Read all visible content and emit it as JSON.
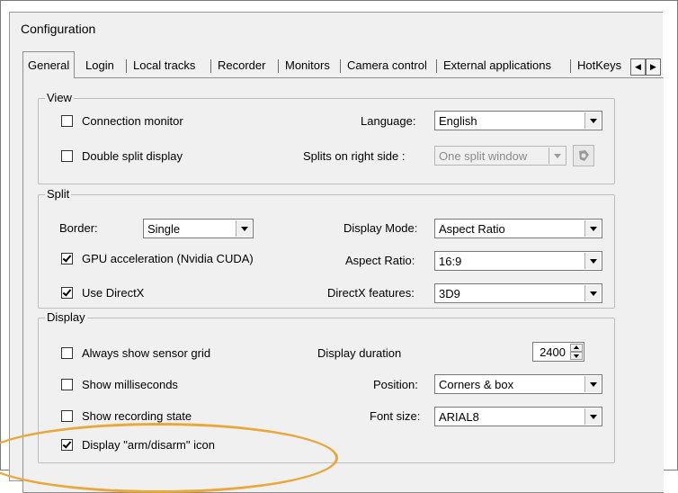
{
  "window": {
    "title": "Configuration"
  },
  "tabs": [
    "General",
    "Login",
    "Local tracks",
    "Recorder",
    "Monitors",
    "Camera control",
    "External applications",
    "HotKeys"
  ],
  "view": {
    "legend": "View",
    "connection_monitor": "Connection monitor",
    "double_split": "Double split display",
    "language_label": "Language:",
    "language_value": "English",
    "splits_label": "Splits on right side :",
    "splits_value": "One split window"
  },
  "split": {
    "legend": "Split",
    "border_label": "Border:",
    "border_value": "Single",
    "gpu_label": "GPU acceleration (Nvidia CUDA)",
    "directx_label": "Use DirectX",
    "display_mode_label": "Display Mode:",
    "display_mode_value": "Aspect Ratio",
    "aspect_ratio_label": "Aspect Ratio:",
    "aspect_ratio_value": "16:9",
    "directx_features_label": "DirectX features:",
    "directx_features_value": "3D9"
  },
  "display": {
    "legend": "Display",
    "sensor_grid": "Always show sensor grid",
    "milliseconds": "Show milliseconds",
    "recording_state": "Show recording state",
    "arm_disarm": "Display \"arm/disarm\" icon",
    "duration_label": "Display duration",
    "duration_value": "2400",
    "position_label": "Position:",
    "position_value": "Corners & box",
    "font_size_label": "Font size:",
    "font_size_value": "ARIAL8"
  },
  "checks": {
    "connection_monitor": false,
    "double_split": false,
    "gpu": true,
    "directx": true,
    "sensor_grid": false,
    "milliseconds": false,
    "recording_state": false,
    "arm_disarm": true
  },
  "colors": {
    "highlight_ellipse": "#e8a83a"
  },
  "icons": {
    "tab_left": "arrow-left-icon",
    "tab_right": "arrow-right-icon",
    "split_settings": "settings-icon"
  }
}
